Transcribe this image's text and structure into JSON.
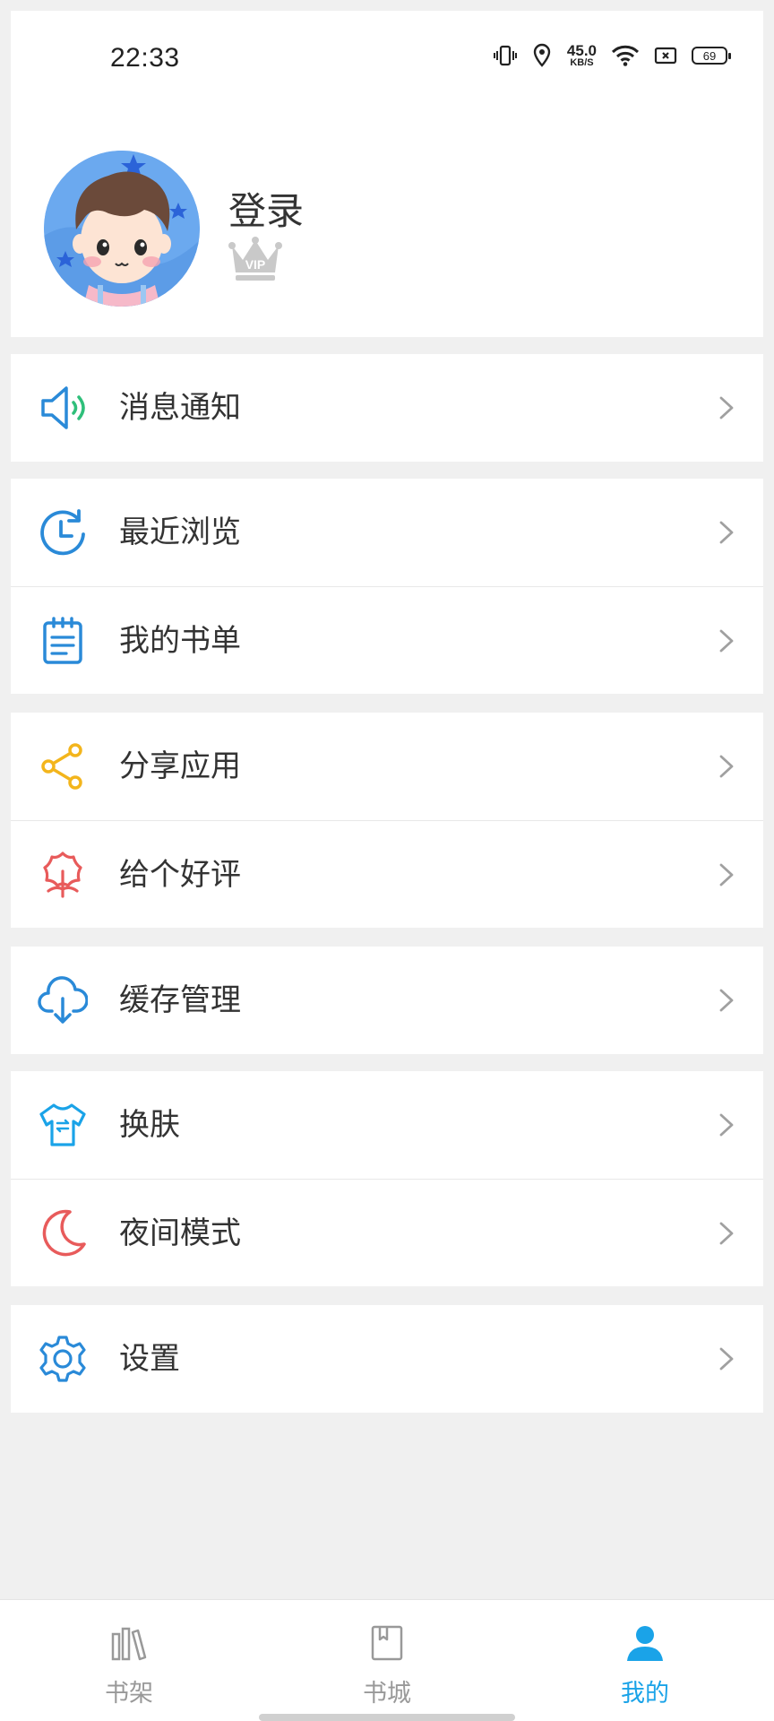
{
  "status_bar": {
    "time": "22:33",
    "net_speed_value": "45.0",
    "net_speed_unit": "KB/S",
    "battery": "69"
  },
  "profile": {
    "login_label": "登录",
    "vip_badge": "VIP",
    "avatar_icon": "cartoon-boy-avatar"
  },
  "menu": {
    "notifications": "消息通知",
    "recent": "最近浏览",
    "booklist": "我的书单",
    "share": "分享应用",
    "rate": "给个好评",
    "cache": "缓存管理",
    "skin": "换肤",
    "night": "夜间模式",
    "settings": "设置"
  },
  "bottom_nav": {
    "bookshelf": "书架",
    "bookstore": "书城",
    "mine": "我的"
  },
  "colors": {
    "accent": "#1aa3e8",
    "blue_icon": "#2a8ad8",
    "green_icon": "#2fbf7a",
    "yellow_icon": "#f3b51c",
    "red_icon": "#e85b5b",
    "inactive": "#999999"
  }
}
